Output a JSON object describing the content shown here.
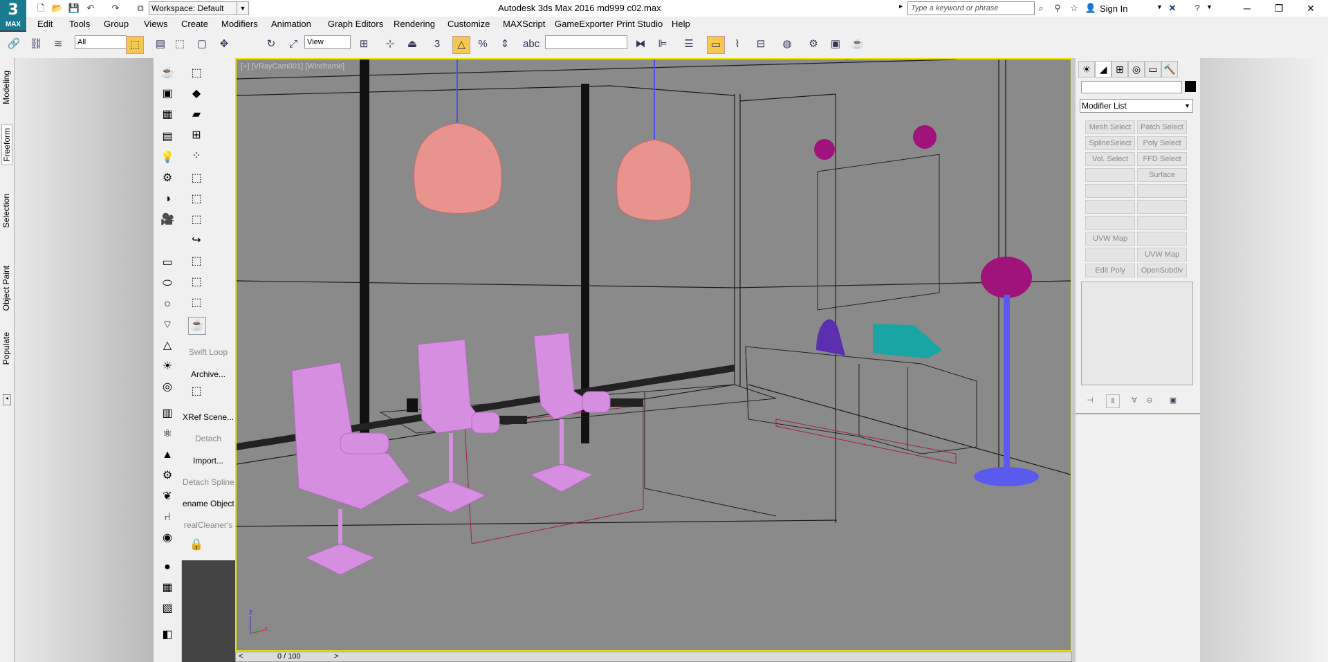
{
  "app": {
    "logo_text": "MAX",
    "window_title": "Autodesk 3ds Max 2016      md999 c02.max",
    "workspace": "Workspace: Default",
    "search_placeholder": "Type a keyword or phrase",
    "sign_in": "Sign In"
  },
  "menu": [
    "Edit",
    "Tools",
    "Group",
    "Views",
    "Create",
    "Modifiers",
    "Animation",
    "Graph Editors",
    "Rendering",
    "Customize",
    "MAXScript",
    "GameExporter",
    "Print Studio",
    "Help"
  ],
  "toolbar": {
    "selection_filter": "All",
    "ref_coord": "View",
    "snap_label": "3"
  },
  "ribbon_tabs": [
    "Modeling",
    "Freeform",
    "Selection",
    "Object Paint",
    "Populate"
  ],
  "command_strip": {
    "swift_loop": "Swift Loop",
    "archive": "Archive...",
    "xref_scene": "XRef Scene...",
    "detach": "Detach",
    "import": "Import...",
    "detach_spline": "Detach Spline",
    "rename_objects": "ename Objects",
    "real_cleaner": "realCleaner",
    "real_cleaner_suffix": "'s"
  },
  "viewport": {
    "label": "[+] [VRayCam001] [Wireframe]",
    "axis_z": "z",
    "axis_y": "y",
    "axis_x": "x"
  },
  "timeslider": {
    "value": "0 / 100",
    "prev": "<",
    "next": ">"
  },
  "command_panel": {
    "modifier_list": "Modifier List",
    "buttons": [
      "Mesh Select",
      "Patch Select",
      "SplineSelect",
      "Poly Select",
      "Vol. Select",
      "FFD Select",
      "",
      "Surface Select",
      "",
      "",
      "",
      "",
      "",
      "",
      "UVW Map",
      "",
      "",
      "UVW Map",
      "Edit Poly",
      "OpenSubdiv"
    ]
  },
  "colors": {
    "viewport_border": "#e6e600",
    "chair": "#d68fe0",
    "lamp": "#e8938e",
    "accent_teal": "#1aa5a5",
    "accent_purple": "#5a2fb0",
    "magenta": "#a0137a",
    "floor_lamp_base": "#5a5aef"
  }
}
